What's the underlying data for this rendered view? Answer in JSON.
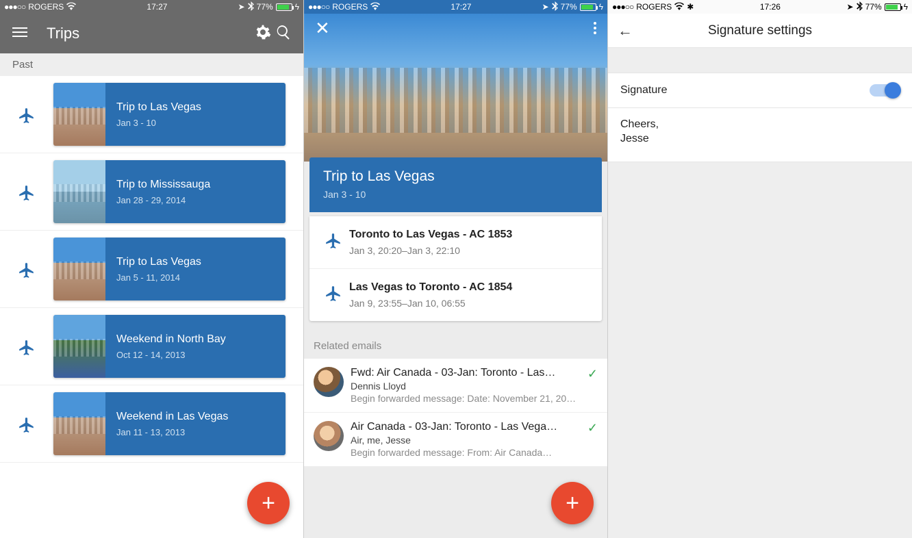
{
  "status_common": {
    "carrier": "ROGERS",
    "battery": "77%"
  },
  "phone1": {
    "time": "17:27",
    "header_title": "Trips",
    "section_label": "Past",
    "trips": [
      {
        "title": "Trip to Las Vegas",
        "subtitle": "Jan 3 - 10"
      },
      {
        "title": "Trip to Mississauga",
        "subtitle": "Jan 28 - 29, 2014"
      },
      {
        "title": "Trip to Las Vegas",
        "subtitle": "Jan 5 - 11, 2014"
      },
      {
        "title": "Weekend in North Bay",
        "subtitle": "Oct 12 - 14, 2013"
      },
      {
        "title": "Weekend in Las Vegas",
        "subtitle": "Jan 11 - 13, 2013"
      }
    ]
  },
  "phone2": {
    "time": "17:27",
    "trip_header": {
      "title": "Trip to Las Vegas",
      "subtitle": "Jan 3 - 10"
    },
    "segments": [
      {
        "title": "Toronto to Las Vegas - AC 1853",
        "subtitle": "Jan 3, 20:20–Jan 3, 22:10"
      },
      {
        "title": "Las Vegas to Toronto - AC 1854",
        "subtitle": "Jan 9, 23:55–Jan 10, 06:55"
      }
    ],
    "related_label": "Related emails",
    "emails": [
      {
        "subject": "Fwd: Air Canada - 03-Jan: Toronto - Las…",
        "from": "Dennis Lloyd",
        "snippet": "Begin forwarded message: Date: November 21, 20…"
      },
      {
        "subject": "Air Canada - 03-Jan: Toronto - Las Vega…",
        "from": "Air, me, Jesse",
        "snippet": "Begin forwarded message: From: Air Canada…"
      }
    ]
  },
  "phone3": {
    "time": "17:26",
    "title": "Signature settings",
    "toggle_label": "Signature",
    "signature_text": "Cheers,\nJesse"
  }
}
